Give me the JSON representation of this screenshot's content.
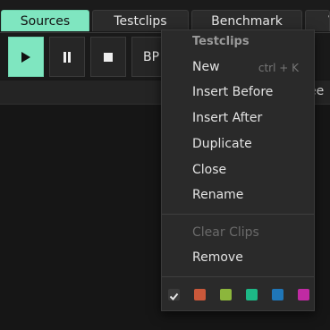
{
  "tabs": [
    {
      "label": "Sources",
      "active": true
    },
    {
      "label": "Testclips",
      "active": false
    },
    {
      "label": "Benchmark",
      "active": false
    },
    {
      "label": "V",
      "active": false
    }
  ],
  "transport": {
    "bpm_label": "BP",
    "play_icon": "play-icon",
    "pause_icon": "pause-icon",
    "stop_icon": "stop-icon"
  },
  "subrow": {
    "text_fragment": "ee"
  },
  "menu": {
    "title": "Testclips",
    "items": [
      {
        "label": "New",
        "shortcut": "ctrl + K",
        "disabled": false
      },
      {
        "label": "Insert Before",
        "shortcut": "",
        "disabled": false
      },
      {
        "label": "Insert After",
        "shortcut": "",
        "disabled": false
      },
      {
        "label": "Duplicate",
        "shortcut": "",
        "disabled": false
      },
      {
        "label": "Close",
        "shortcut": "",
        "disabled": false
      },
      {
        "label": "Rename",
        "shortcut": "",
        "disabled": false
      }
    ],
    "items2": [
      {
        "label": "Clear Clips",
        "disabled": true
      },
      {
        "label": "Remove",
        "disabled": false
      }
    ],
    "colors": [
      {
        "name": "default",
        "hex": "#3a3a3a",
        "selected": true
      },
      {
        "name": "orange",
        "hex": "#c9583a",
        "selected": false
      },
      {
        "name": "lime",
        "hex": "#8cb63c",
        "selected": false
      },
      {
        "name": "green",
        "hex": "#1db886",
        "selected": false
      },
      {
        "name": "blue",
        "hex": "#1f76b8",
        "selected": false
      },
      {
        "name": "magenta",
        "hex": "#c02aa3",
        "selected": false
      }
    ]
  },
  "colors": {
    "accent": "#7fe6c0",
    "background": "#161616",
    "menu_bg": "#2a2a2a"
  }
}
